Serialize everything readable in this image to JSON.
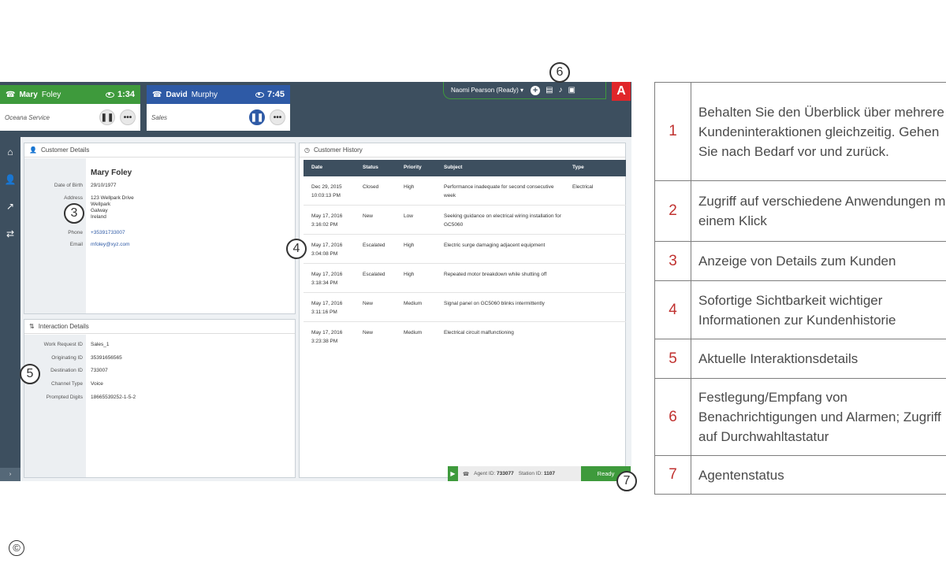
{
  "calls": [
    {
      "first": "Mary",
      "last": "Foley",
      "timer": "1:34",
      "queue": "Oceana Service"
    },
    {
      "first": "David",
      "last": "Murphy",
      "timer": "7:45",
      "queue": "Sales"
    }
  ],
  "agent_menu": {
    "label": "Naomi Pearson (Ready)",
    "chevron": "▾"
  },
  "brand": "A",
  "customer_details": {
    "title": "Customer Details",
    "name": "Mary Foley",
    "fields": [
      {
        "label": "Date of Birth",
        "value": "29/10/1977"
      },
      {
        "label": "Address",
        "value": "123 Wellpark Drive"
      },
      {
        "label": "Phone",
        "value": "+35391733007"
      },
      {
        "label": "Email",
        "value": "mfoley@xyz.com"
      }
    ],
    "address_extra": [
      "Wellpark",
      "Galway",
      "Ireland"
    ]
  },
  "interaction_details": {
    "title": "Interaction Details",
    "fields": [
      {
        "label": "Work Request ID",
        "value": "Sales_1"
      },
      {
        "label": "Originating ID",
        "value": "35391656565"
      },
      {
        "label": "Destination ID",
        "value": "733007"
      },
      {
        "label": "Channel Type",
        "value": "Voice"
      },
      {
        "label": "Prompted Digits",
        "value": "18665539252-1-5-2"
      }
    ]
  },
  "customer_history": {
    "title": "Customer History",
    "columns": [
      "Date",
      "Status",
      "Priority",
      "Subject",
      "Type"
    ],
    "rows": [
      {
        "date": "Dec 29, 2015",
        "time": "10:03:13 PM",
        "status": "Closed",
        "priority": "High",
        "subject": "Performance inadequate for second consecutive week",
        "type": "Electrical"
      },
      {
        "date": "May 17, 2016",
        "time": "3:16:02 PM",
        "status": "New",
        "priority": "Low",
        "subject": "Seeking guidance on electrical wiring installation for GC5060",
        "type": ""
      },
      {
        "date": "May 17, 2016",
        "time": "3:04:08 PM",
        "status": "Escalated",
        "priority": "High",
        "subject": "Electric surge damaging adjacent equipment",
        "type": ""
      },
      {
        "date": "May 17, 2016",
        "time": "3:18:34 PM",
        "status": "Escalated",
        "priority": "High",
        "subject": "Repeated motor breakdown while shutting off",
        "type": ""
      },
      {
        "date": "May 17, 2016",
        "time": "3:11:16 PM",
        "status": "New",
        "priority": "Medium",
        "subject": "Signal panel on GC5060 blinks intermittently",
        "type": ""
      },
      {
        "date": "May 17, 2016",
        "time": "3:23:38 PM",
        "status": "New",
        "priority": "Medium",
        "subject": "Electrical circuit malfunctioning",
        "type": ""
      }
    ]
  },
  "agent_bar": {
    "agent_label": "Agent ID:",
    "agent_id": "733077",
    "station_label": "Station ID:",
    "station_id": "1107",
    "status": "Ready"
  },
  "markers": [
    "3",
    "4",
    "5",
    "6",
    "7"
  ],
  "legend": [
    {
      "num": "1",
      "text": "Behalten Sie den Überblick über mehrere Kundeninteraktionen gleichzeitig. Gehen Sie nach Bedarf vor und zurück."
    },
    {
      "num": "2",
      "text": "Zugriff auf verschiedene Anwendungen mit einem Klick"
    },
    {
      "num": "3",
      "text": "Anzeige von Details zum Kunden"
    },
    {
      "num": "4",
      "text": "Sofortige Sichtbarkeit wichtiger Informationen zur Kundenhistorie"
    },
    {
      "num": "5",
      "text": "Aktuelle Interaktionsdetails"
    },
    {
      "num": "6",
      "text": "Festlegung/Empfang von Benachrichtigungen und Alarmen; Zugriff auf Durchwahltastatur"
    },
    {
      "num": "7",
      "text": "Agentenstatus"
    }
  ],
  "copyright": "©",
  "colors": {
    "accent_green": "#3e9a3c",
    "accent_blue": "#2e5aa6",
    "chrome": "#3d4f5f",
    "legend_number": "#c0312f",
    "brand_red": "#e0262a"
  }
}
